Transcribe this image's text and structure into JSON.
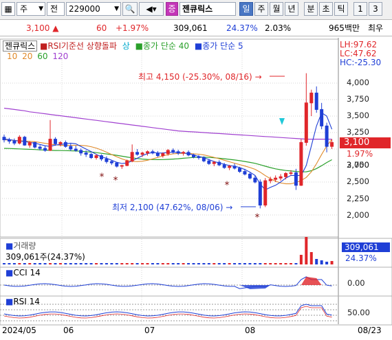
{
  "toolbar": {
    "market": "주",
    "type": "전",
    "code": "229000",
    "badge": "증",
    "stock_name": "젠큐릭스",
    "tabs": [
      "일",
      "주",
      "월",
      "년",
      "분",
      "초",
      "틱",
      "1",
      "3"
    ],
    "active_tab": "일"
  },
  "info": {
    "price": "3,100",
    "change": "60",
    "change_pct": "+1.97%",
    "volume": "309,061",
    "turnover_pct": "24.37%",
    "ratio": "2.03%",
    "amount": "965백만",
    "extra": "최우"
  },
  "legend": {
    "stock": "젠큐릭스",
    "rsi_label": "RSI기준선 상향돌파",
    "rsi_state": "상",
    "ma1": "종가 단순 40",
    "ma2": "종가 단순 5",
    "periods": [
      "10",
      "20",
      "60",
      "120"
    ]
  },
  "stats": {
    "lh": "LH:97.62",
    "lc": "LC:47.62",
    "hc": "HC:-25.30"
  },
  "annotations": {
    "high": "최고 4,150 (-25.30%, 08/16)",
    "low": "최저 2,100 (47.62%, 08/06)"
  },
  "price_axis": [
    "4,000",
    "3,750",
    "3,500",
    "3,250",
    "3,000",
    "2,750",
    "2,500",
    "2,250",
    "2,000"
  ],
  "current": {
    "price": "3,100",
    "pct": "1.97%"
  },
  "volume_panel": {
    "title": "거래량",
    "value": "309,061주(24.37%)",
    "badge": "309,061",
    "badge_pct": "24.37%"
  },
  "cci_panel": {
    "title": "CCI 14",
    "axis": "0.00"
  },
  "rsi_panel": {
    "title": "RSI 14",
    "axis": "50.00"
  },
  "x_axis": {
    "labels": [
      "2024/05",
      "06",
      "07",
      "08"
    ],
    "right": "08/23"
  },
  "colors": {
    "up": "#e0262a",
    "down": "#1f3fd6",
    "ma5": "#1f3fd6",
    "ma20": "#e08a2a",
    "ma40": "#2aa02a",
    "ma120": "#a040d0"
  },
  "chart_data": {
    "type": "candlestick",
    "candles": [
      [
        3180,
        3220,
        3100,
        3140
      ],
      [
        3140,
        3170,
        3080,
        3120
      ],
      [
        3120,
        3160,
        3060,
        3090
      ],
      [
        3090,
        3210,
        3070,
        3180
      ],
      [
        3180,
        3200,
        3050,
        3060
      ],
      [
        3060,
        3120,
        3020,
        3100
      ],
      [
        3100,
        3110,
        3010,
        3030
      ],
      [
        3030,
        3060,
        2980,
        3010
      ],
      [
        3010,
        3050,
        2960,
        2980
      ],
      [
        2980,
        3440,
        2970,
        3150
      ],
      [
        3150,
        3180,
        3050,
        3080
      ],
      [
        3080,
        3120,
        3040,
        3100
      ],
      [
        3100,
        3130,
        3020,
        3040
      ],
      [
        3040,
        3080,
        2970,
        3000
      ],
      [
        3000,
        3050,
        2960,
        2980
      ],
      [
        2980,
        3010,
        2900,
        2940
      ],
      [
        2940,
        2980,
        2880,
        2920
      ],
      [
        2920,
        2940,
        2850,
        2870
      ],
      [
        2870,
        2920,
        2840,
        2900
      ],
      [
        2900,
        2920,
        2820,
        2850
      ],
      [
        2850,
        2890,
        2780,
        2810
      ],
      [
        2810,
        2830,
        2760,
        2790
      ],
      [
        2790,
        2800,
        2720,
        2740
      ],
      [
        2740,
        2760,
        2700,
        2750
      ],
      [
        2750,
        2840,
        2740,
        2820
      ],
      [
        2820,
        3070,
        2800,
        2950
      ],
      [
        2950,
        3000,
        2900,
        2920
      ],
      [
        2920,
        2960,
        2880,
        2940
      ],
      [
        2940,
        2980,
        2900,
        2960
      ],
      [
        2960,
        2990,
        2920,
        2940
      ],
      [
        2940,
        2970,
        2880,
        2900
      ],
      [
        2900,
        2950,
        2870,
        2930
      ],
      [
        2930,
        3000,
        2900,
        2980
      ],
      [
        2980,
        3010,
        2930,
        2960
      ],
      [
        2960,
        2990,
        2910,
        2940
      ],
      [
        2940,
        2970,
        2900,
        2950
      ],
      [
        2950,
        2980,
        2890,
        2910
      ],
      [
        2910,
        2930,
        2860,
        2880
      ],
      [
        2880,
        2910,
        2840,
        2870
      ],
      [
        2870,
        2890,
        2800,
        2820
      ],
      [
        2820,
        2850,
        2760,
        2780
      ],
      [
        2780,
        2820,
        2740,
        2800
      ],
      [
        2800,
        2830,
        2740,
        2760
      ],
      [
        2760,
        2790,
        2700,
        2720
      ],
      [
        2720,
        2760,
        2680,
        2740
      ],
      [
        2740,
        2780,
        2690,
        2710
      ],
      [
        2710,
        2730,
        2640,
        2660
      ],
      [
        2660,
        2700,
        2600,
        2620
      ],
      [
        2620,
        2640,
        2540,
        2560
      ],
      [
        2560,
        2600,
        2480,
        2500
      ],
      [
        2500,
        2540,
        2100,
        2150
      ],
      [
        2150,
        2560,
        2120,
        2520
      ],
      [
        2520,
        2580,
        2480,
        2540
      ],
      [
        2540,
        2600,
        2500,
        2560
      ],
      [
        2560,
        2620,
        2520,
        2580
      ],
      [
        2580,
        2650,
        2540,
        2630
      ],
      [
        2630,
        2680,
        2600,
        2640
      ],
      [
        2640,
        2700,
        2380,
        2450
      ],
      [
        2450,
        3150,
        2440,
        3100
      ],
      [
        3100,
        4150,
        3050,
        3700
      ],
      [
        3700,
        3900,
        3500,
        3850
      ],
      [
        3850,
        3950,
        3550,
        3600
      ],
      [
        3600,
        3700,
        3300,
        3350
      ],
      [
        3350,
        3400,
        2950,
        3040
      ],
      [
        3040,
        3150,
        3000,
        3100
      ]
    ],
    "ma5": [
      3150,
      3145,
      3130,
      3120,
      3115,
      3100,
      3090,
      3070,
      3050,
      3040,
      3060,
      3070,
      3080,
      3090,
      3080,
      3040,
      3000,
      2960,
      2920,
      2880,
      2860,
      2830,
      2800,
      2780,
      2790,
      2820,
      2860,
      2900,
      2930,
      2950,
      2940,
      2940,
      2950,
      2950,
      2950,
      2940,
      2930,
      2910,
      2890,
      2870,
      2840,
      2810,
      2790,
      2770,
      2750,
      2740,
      2720,
      2690,
      2650,
      2600,
      2470,
      2380,
      2420,
      2450,
      2500,
      2560,
      2600,
      2600,
      2600,
      2750,
      3050,
      3350,
      3550,
      3500,
      3300
    ],
    "ma120": [
      3620,
      3610,
      3600,
      3590,
      3580,
      3565,
      3555,
      3545,
      3535,
      3525,
      3515,
      3505,
      3495,
      3485,
      3475,
      3465,
      3455,
      3445,
      3435,
      3425,
      3415,
      3405,
      3395,
      3385,
      3375,
      3365,
      3355,
      3345,
      3335,
      3325,
      3315,
      3305,
      3295,
      3285,
      3275,
      3270,
      3265,
      3260,
      3255,
      3250,
      3245,
      3240,
      3235,
      3230,
      3225,
      3220,
      3215,
      3210,
      3205,
      3200,
      3195,
      3190,
      3185,
      3180,
      3175,
      3170,
      3165,
      3160,
      3155,
      3150,
      3150,
      3150,
      3150,
      3150,
      3150
    ]
  }
}
